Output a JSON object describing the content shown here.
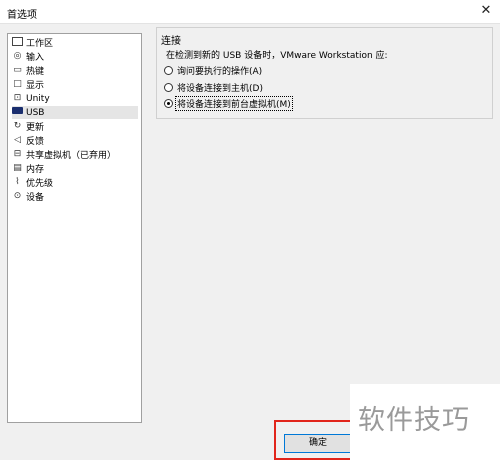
{
  "window": {
    "title": "首选项",
    "close_glyph": "✕"
  },
  "sidebar": {
    "items": [
      {
        "label": "工作区",
        "icon": "workspace-icon"
      },
      {
        "label": "输入",
        "icon": "mouse-icon"
      },
      {
        "label": "热键",
        "icon": "keyboard-icon"
      },
      {
        "label": "显示",
        "icon": "monitor-icon"
      },
      {
        "label": "Unity",
        "icon": "unity-icon"
      },
      {
        "label": "USB",
        "icon": "usb-icon",
        "selected": true
      },
      {
        "label": "更新",
        "icon": "refresh-icon"
      },
      {
        "label": "反馈",
        "icon": "megaphone-icon"
      },
      {
        "label": "共享虚拟机（已弃用）",
        "icon": "shared-vm-icon"
      },
      {
        "label": "内存",
        "icon": "memory-icon"
      },
      {
        "label": "优先级",
        "icon": "priority-icon"
      },
      {
        "label": "设备",
        "icon": "device-icon"
      }
    ]
  },
  "connection": {
    "title": "连接",
    "question": "在检测到新的 USB 设备时，VMware Workstation 应:",
    "options": [
      {
        "label": "询问要执行的操作(A)",
        "checked": false
      },
      {
        "label": "将设备连接到主机(D)",
        "checked": false
      },
      {
        "label": "将设备连接到前台虚拟机(M)",
        "checked": true
      }
    ]
  },
  "footer": {
    "ok_label": "确定"
  },
  "watermark": "软件技巧",
  "colors": {
    "highlight": "#e1251b",
    "focus_border": "#0078d7"
  }
}
